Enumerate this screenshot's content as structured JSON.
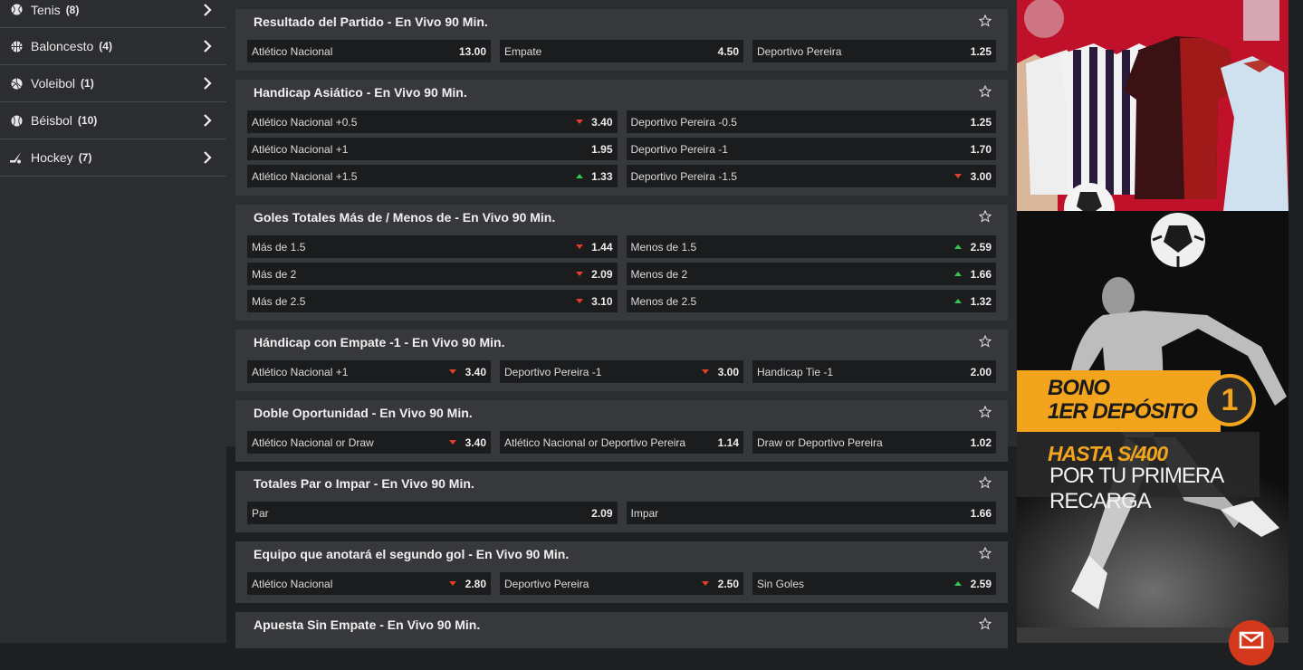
{
  "sidebar": {
    "items": [
      {
        "label": "Tenis",
        "count": "(8)",
        "icon": "tennis-ball-icon"
      },
      {
        "label": "Baloncesto",
        "count": "(4)",
        "icon": "basketball-icon"
      },
      {
        "label": "Voleibol",
        "count": "(1)",
        "icon": "volleyball-icon"
      },
      {
        "label": "Béisbol",
        "count": "(10)",
        "icon": "baseball-icon"
      },
      {
        "label": "Hockey",
        "count": "(7)",
        "icon": "hockey-stick-icon"
      }
    ]
  },
  "markets": [
    {
      "title": "Resultado del Partido - En Vivo 90 Min.",
      "odds": [
        {
          "name": "Atlético Nacional",
          "price": "13.00",
          "trend": "none"
        },
        {
          "name": "Empate",
          "price": "4.50",
          "trend": "none"
        },
        {
          "name": "Deportivo Pereira",
          "price": "1.25",
          "trend": "none"
        }
      ]
    },
    {
      "title": "Handicap Asiático - En Vivo 90 Min.",
      "odds": [
        {
          "name": "Atlético Nacional +0.5",
          "price": "3.40",
          "trend": "down"
        },
        {
          "name": "Deportivo Pereira -0.5",
          "price": "1.25",
          "trend": "none"
        },
        {
          "name": "Atlético Nacional +1",
          "price": "1.95",
          "trend": "none"
        },
        {
          "name": "Deportivo Pereira -1",
          "price": "1.70",
          "trend": "none"
        },
        {
          "name": "Atlético Nacional +1.5",
          "price": "1.33",
          "trend": "up"
        },
        {
          "name": "Deportivo Pereira -1.5",
          "price": "3.00",
          "trend": "down"
        }
      ]
    },
    {
      "title": "Goles Totales Más de / Menos de - En Vivo 90 Min.",
      "odds": [
        {
          "name": "Más de 1.5",
          "price": "1.44",
          "trend": "down"
        },
        {
          "name": "Menos de 1.5",
          "price": "2.59",
          "trend": "up"
        },
        {
          "name": "Más de 2",
          "price": "2.09",
          "trend": "down"
        },
        {
          "name": "Menos de 2",
          "price": "1.66",
          "trend": "up"
        },
        {
          "name": "Más de 2.5",
          "price": "3.10",
          "trend": "down"
        },
        {
          "name": "Menos de 2.5",
          "price": "1.32",
          "trend": "up"
        }
      ]
    },
    {
      "title": "Hándicap con Empate -1 - En Vivo 90 Min.",
      "odds": [
        {
          "name": "Atlético Nacional +1",
          "price": "3.40",
          "trend": "down"
        },
        {
          "name": "Deportivo Pereira -1",
          "price": "3.00",
          "trend": "down"
        },
        {
          "name": "Handicap Tie -1",
          "price": "2.00",
          "trend": "none"
        }
      ]
    },
    {
      "title": "Doble Oportunidad - En Vivo 90 Min.",
      "odds": [
        {
          "name": "Atlético Nacional or Draw",
          "price": "3.40",
          "trend": "down"
        },
        {
          "name": "Atlético Nacional or Deportivo Pereira",
          "price": "1.14",
          "trend": "none"
        },
        {
          "name": "Draw or Deportivo Pereira",
          "price": "1.02",
          "trend": "none"
        }
      ]
    },
    {
      "title": "Totales Par o Impar - En Vivo 90 Min.",
      "odds": [
        {
          "name": "Par",
          "price": "2.09",
          "trend": "none"
        },
        {
          "name": "Impar",
          "price": "1.66",
          "trend": "none"
        }
      ]
    },
    {
      "title": "Equipo que anotará el segundo gol - En Vivo 90 Min.",
      "odds": [
        {
          "name": "Atlético Nacional",
          "price": "2.80",
          "trend": "down"
        },
        {
          "name": "Deportivo Pereira",
          "price": "2.50",
          "trend": "down"
        },
        {
          "name": "Sin Goles",
          "price": "2.59",
          "trend": "up"
        }
      ]
    },
    {
      "title": "Apuesta Sin Empate - En Vivo 90 Min.",
      "odds": []
    }
  ],
  "banner": {
    "bono_line1": "BONO",
    "bono_line2": "1ER DEPÓSITO",
    "circle_number": "1",
    "hasta": "HASTA S/400",
    "recarga": "POR TU PRIMERA RECARGA"
  },
  "colors": {
    "trend_down": "#e0402a",
    "trend_up": "#38c24a",
    "promo_orange": "#f2a51c"
  }
}
